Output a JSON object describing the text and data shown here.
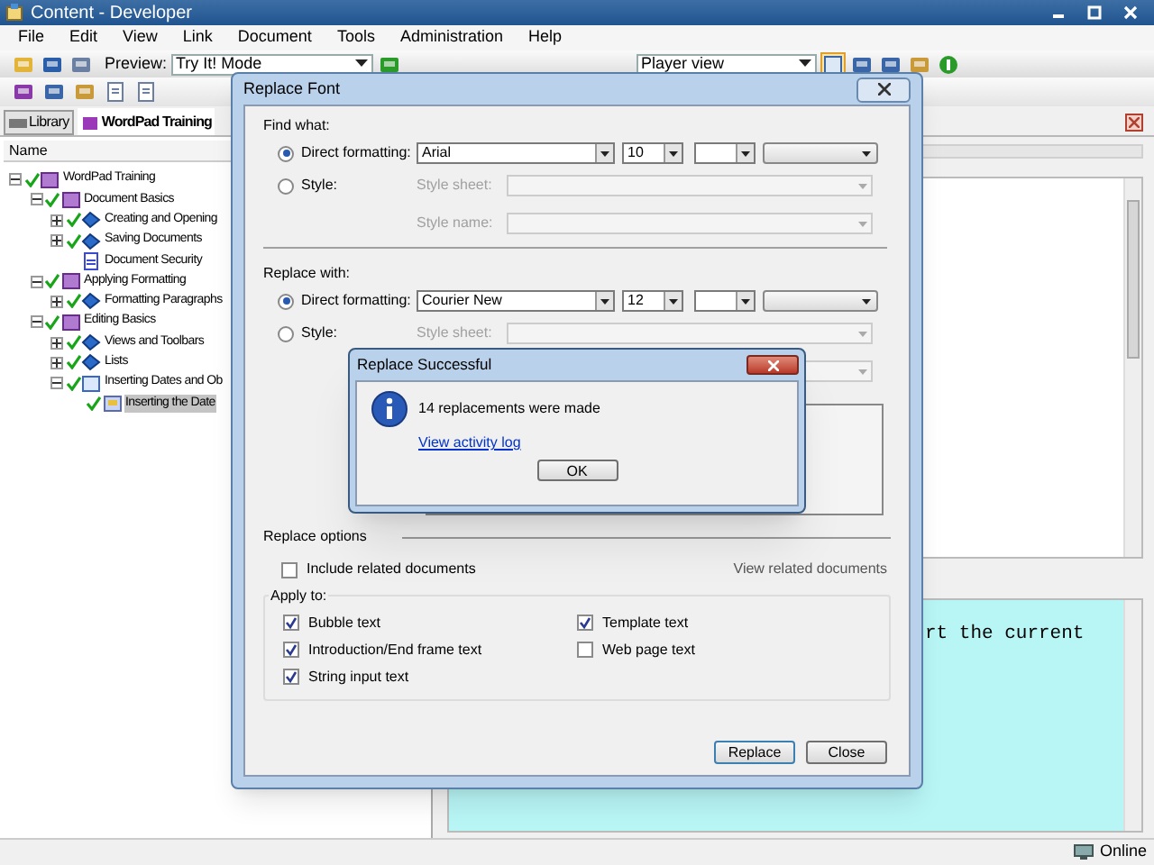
{
  "window": {
    "title": "Content - Developer"
  },
  "menu": [
    "File",
    "Edit",
    "View",
    "Link",
    "Document",
    "Tools",
    "Administration",
    "Help"
  ],
  "toolbar": {
    "preview_label": "Preview:",
    "preview_mode": "Try It! Mode",
    "view_mode": "Player view"
  },
  "tabs": [
    {
      "label": "Library",
      "selected": false
    },
    {
      "label": "WordPad Training",
      "selected": true
    }
  ],
  "tree": {
    "column": "Name",
    "items": [
      {
        "label": "WordPad Training",
        "kind": "module",
        "checked": true,
        "expanded": true,
        "children": [
          {
            "label": "Document Basics",
            "kind": "module",
            "checked": true,
            "expanded": true,
            "children": [
              {
                "label": "Creating and Opening",
                "kind": "topic",
                "checked": true,
                "expanded": false
              },
              {
                "label": "Saving Documents",
                "kind": "topic",
                "checked": true,
                "expanded": false
              },
              {
                "label": "Document Security",
                "kind": "document",
                "checked": false
              }
            ]
          },
          {
            "label": "Applying Formatting",
            "kind": "module",
            "checked": true,
            "expanded": true,
            "children": [
              {
                "label": "Formatting Paragraphs",
                "kind": "topic",
                "checked": true,
                "expanded": false
              }
            ]
          },
          {
            "label": "Editing Basics",
            "kind": "module",
            "checked": true,
            "expanded": true,
            "children": [
              {
                "label": "Views and Toolbars",
                "kind": "topic",
                "checked": true,
                "expanded": false
              },
              {
                "label": "Lists",
                "kind": "topic",
                "checked": true,
                "expanded": false
              },
              {
                "label": "Inserting Dates and Ob",
                "kind": "section",
                "checked": true,
                "expanded": true,
                "children": [
                  {
                    "label": "Inserting the Date",
                    "kind": "frame",
                    "checked": true,
                    "selected": true
                  }
                ]
              }
            ]
          }
        ]
      }
    ]
  },
  "editor": {
    "text": "rt the current"
  },
  "replace_font": {
    "title": "Replace Font",
    "find": {
      "heading": "Find what:",
      "options": [
        {
          "label": "Direct formatting:",
          "selected": true
        },
        {
          "label": "Style:",
          "selected": false
        }
      ],
      "font": "Arial",
      "size": "10",
      "style_sheet_label": "Style sheet:",
      "style_name_label": "Style name:"
    },
    "replace": {
      "heading": "Replace with:",
      "options": [
        {
          "label": "Direct formatting:",
          "selected": true
        },
        {
          "label": "Style:",
          "selected": false
        }
      ],
      "font": "Courier New",
      "size": "12",
      "style_sheet_label": "Style sheet:"
    },
    "replace_options": {
      "heading": "Replace options",
      "include_related": {
        "label": "Include related documents",
        "checked": false
      },
      "view_related": "View related documents"
    },
    "apply_to": {
      "heading": "Apply to:",
      "items": [
        {
          "label": "Bubble text",
          "checked": true
        },
        {
          "label": "Template text",
          "checked": true
        },
        {
          "label": "Introduction/End frame text",
          "checked": true
        },
        {
          "label": "Web page text",
          "checked": false
        },
        {
          "label": "String input text",
          "checked": true
        }
      ]
    },
    "buttons": [
      "Replace",
      "Close"
    ]
  },
  "message": {
    "title": "Replace Successful",
    "text": "14 replacements were made",
    "link": "View activity log",
    "button": "OK"
  },
  "status_bar": {
    "text": "Online"
  }
}
